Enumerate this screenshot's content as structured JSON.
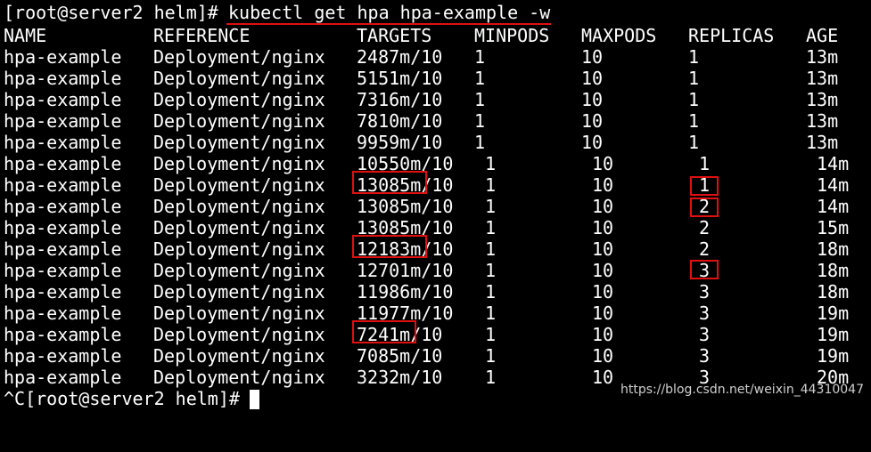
{
  "terminal": {
    "prompt": "[root@server2 helm]# ",
    "command": "kubectl get hpa hpa-example -w",
    "end_prompt": "^C[root@server2 helm]# ",
    "headers": [
      "NAME",
      "REFERENCE",
      "TARGETS",
      "MINPODS",
      "MAXPODS",
      "REPLICAS",
      "AGE"
    ],
    "rows": [
      {
        "name": "hpa-example",
        "reference": "Deployment/nginx",
        "targets": "2487m/10",
        "minpods": "1",
        "maxpods": "10",
        "replicas": "1",
        "age": "13m"
      },
      {
        "name": "hpa-example",
        "reference": "Deployment/nginx",
        "targets": "5151m/10",
        "minpods": "1",
        "maxpods": "10",
        "replicas": "1",
        "age": "13m"
      },
      {
        "name": "hpa-example",
        "reference": "Deployment/nginx",
        "targets": "7316m/10",
        "minpods": "1",
        "maxpods": "10",
        "replicas": "1",
        "age": "13m"
      },
      {
        "name": "hpa-example",
        "reference": "Deployment/nginx",
        "targets": "7810m/10",
        "minpods": "1",
        "maxpods": "10",
        "replicas": "1",
        "age": "13m"
      },
      {
        "name": "hpa-example",
        "reference": "Deployment/nginx",
        "targets": "9959m/10",
        "minpods": "1",
        "maxpods": "10",
        "replicas": "1",
        "age": "13m"
      },
      {
        "name": "hpa-example",
        "reference": "Deployment/nginx",
        "targets": "10550m/10",
        "minpods": "1",
        "maxpods": "10",
        "replicas": "1",
        "age": "14m"
      },
      {
        "name": "hpa-example",
        "reference": "Deployment/nginx",
        "targets": "13085m/10",
        "minpods": "1",
        "maxpods": "10",
        "replicas": "1",
        "age": "14m"
      },
      {
        "name": "hpa-example",
        "reference": "Deployment/nginx",
        "targets": "13085m/10",
        "minpods": "1",
        "maxpods": "10",
        "replicas": "2",
        "age": "14m"
      },
      {
        "name": "hpa-example",
        "reference": "Deployment/nginx",
        "targets": "13085m/10",
        "minpods": "1",
        "maxpods": "10",
        "replicas": "2",
        "age": "15m"
      },
      {
        "name": "hpa-example",
        "reference": "Deployment/nginx",
        "targets": "12183m/10",
        "minpods": "1",
        "maxpods": "10",
        "replicas": "2",
        "age": "18m"
      },
      {
        "name": "hpa-example",
        "reference": "Deployment/nginx",
        "targets": "12701m/10",
        "minpods": "1",
        "maxpods": "10",
        "replicas": "3",
        "age": "18m"
      },
      {
        "name": "hpa-example",
        "reference": "Deployment/nginx",
        "targets": "11986m/10",
        "minpods": "1",
        "maxpods": "10",
        "replicas": "3",
        "age": "18m"
      },
      {
        "name": "hpa-example",
        "reference": "Deployment/nginx",
        "targets": "11977m/10",
        "minpods": "1",
        "maxpods": "10",
        "replicas": "3",
        "age": "19m"
      },
      {
        "name": "hpa-example",
        "reference": "Deployment/nginx",
        "targets": "7241m/10",
        "minpods": "1",
        "maxpods": "10",
        "replicas": "3",
        "age": "19m"
      },
      {
        "name": "hpa-example",
        "reference": "Deployment/nginx",
        "targets": "7085m/10",
        "minpods": "1",
        "maxpods": "10",
        "replicas": "3",
        "age": "19m"
      },
      {
        "name": "hpa-example",
        "reference": "Deployment/nginx",
        "targets": "3232m/10",
        "minpods": "1",
        "maxpods": "10",
        "replicas": "3",
        "age": "20m"
      }
    ]
  },
  "watermark": "https://blog.csdn.net/weixin_44310047",
  "colors": {
    "background": "#000000",
    "text": "#ffffff",
    "highlight": "#e01010"
  }
}
